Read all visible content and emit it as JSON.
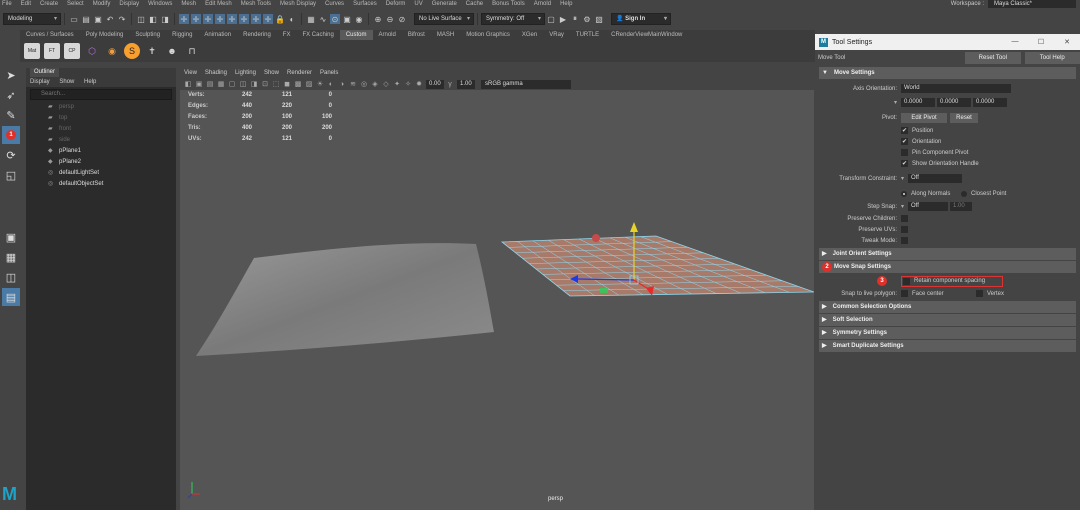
{
  "menubar": [
    "File",
    "Edit",
    "Create",
    "Select",
    "Modify",
    "Display",
    "Windows",
    "Mesh",
    "Edit Mesh",
    "Mesh Tools",
    "Mesh Display",
    "Curves",
    "Surfaces",
    "Deform",
    "UV",
    "Generate",
    "Cache",
    "Bonus Tools",
    "Arnold",
    "Help"
  ],
  "workspace": {
    "label": "Workspace :",
    "value": "Maya Classic*"
  },
  "statusline": {
    "mode": "Modeling",
    "live_surface": "No Live Surface",
    "symmetry": "Symmetry: Off",
    "sign_in": "Sign In"
  },
  "shelf_tabs": [
    "Curves / Surfaces",
    "Poly Modeling",
    "Sculpting",
    "Rigging",
    "Animation",
    "Rendering",
    "FX",
    "FX Caching",
    "Custom",
    "Arnold",
    "Bifrost",
    "MASH",
    "Motion Graphics",
    "XGen",
    "VRay",
    "TURTLE",
    "CRenderViewMainWindow"
  ],
  "shelf_active": "Custom",
  "shelf_buttons": [
    {
      "label": "Mat",
      "color": "#ddd"
    },
    {
      "label": "FT",
      "color": "#ddd"
    },
    {
      "label": "CP",
      "color": "#ddd"
    }
  ],
  "outliner": {
    "title": "Outliner",
    "menu": [
      "Display",
      "Show",
      "Help"
    ],
    "search_placeholder": "Search...",
    "items": [
      {
        "name": "persp",
        "dim": true,
        "icon": "camera-icon"
      },
      {
        "name": "top",
        "dim": true,
        "icon": "camera-icon"
      },
      {
        "name": "front",
        "dim": true,
        "icon": "camera-icon"
      },
      {
        "name": "side",
        "dim": true,
        "icon": "camera-icon"
      },
      {
        "name": "pPlane1",
        "dim": false,
        "icon": "mesh-icon"
      },
      {
        "name": "pPlane2",
        "dim": false,
        "icon": "mesh-icon"
      },
      {
        "name": "defaultLightSet",
        "dim": false,
        "icon": "set-icon"
      },
      {
        "name": "defaultObjectSet",
        "dim": false,
        "icon": "set-icon"
      }
    ]
  },
  "viewport": {
    "menu": [
      "View",
      "Shading",
      "Lighting",
      "Show",
      "Renderer",
      "Panels"
    ],
    "exposure": "0.00",
    "gamma_value": "1.00",
    "color_space": "sRGB gamma",
    "camera": "persp",
    "hud": [
      {
        "label": "Verts:",
        "a": "242",
        "b": "121",
        "c": "0"
      },
      {
        "label": "Edges:",
        "a": "440",
        "b": "220",
        "c": "0"
      },
      {
        "label": "Faces:",
        "a": "200",
        "b": "100",
        "c": "100"
      },
      {
        "label": "Tris:",
        "a": "400",
        "b": "200",
        "c": "200"
      },
      {
        "label": "UVs:",
        "a": "242",
        "b": "121",
        "c": "0"
      }
    ]
  },
  "tool_settings": {
    "window_title": "Tool Settings",
    "tool_name": "Move Tool",
    "reset_label": "Reset Tool",
    "help_label": "Tool Help",
    "move_settings": "Move Settings",
    "axis_orientation_label": "Axis Orientation:",
    "axis_orientation_value": "World",
    "xyz": [
      "0.0000",
      "0.0000",
      "0.0000"
    ],
    "pivot_label": "Pivot:",
    "edit_pivot": "Edit Pivot",
    "reset": "Reset",
    "pivot_checks": [
      {
        "label": "Position",
        "checked": true
      },
      {
        "label": "Orientation",
        "checked": true
      },
      {
        "label": "Pin Component Pivot",
        "checked": false
      },
      {
        "label": "Show Orientation Handle",
        "checked": true
      }
    ],
    "transform_constraint_label": "Transform Constraint:",
    "transform_constraint_value": "Off",
    "along_normals": "Along Normals",
    "closest_point": "Closest Point",
    "step_snap_label": "Step Snap:",
    "step_snap_value": "Off",
    "step_snap_num": "1.00",
    "preserve_children": "Preserve Children:",
    "preserve_uvs": "Preserve UVs:",
    "tweak_mode": "Tweak Mode:",
    "joint_orient": "Joint Orient Settings",
    "move_snap": "Move Snap Settings",
    "retain_spacing": "Retain component spacing",
    "snap_live_label": "Snap to live polygon:",
    "face_center": "Face center",
    "vertex": "Vertex",
    "sections": [
      "Common Selection Options",
      "Soft Selection",
      "Symmetry Settings",
      "Smart Duplicate Settings"
    ]
  },
  "badges": {
    "one": "1",
    "two": "2",
    "three": "3"
  }
}
